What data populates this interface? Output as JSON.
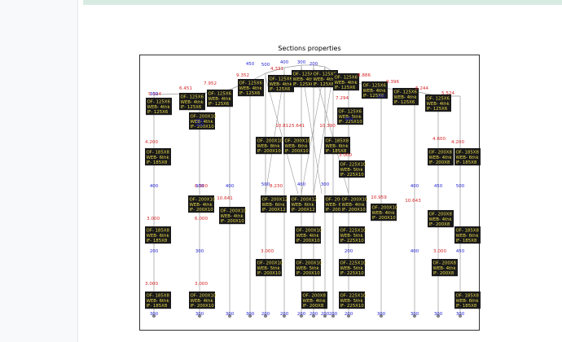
{
  "chart_data": {
    "type": "diagram",
    "title": "Sections properties",
    "labels": [
      {
        "lines": [
          "OF- 125X6",
          "WEB- 4thk",
          "IF- 125X6"
        ]
      },
      {
        "lines": [
          "OF- 125X6",
          "WEB- 4thk",
          "IF- 125X6"
        ]
      },
      {
        "lines": [
          "OF- 125X6",
          "WEB- 4thk",
          "IF- 125X6"
        ]
      },
      {
        "lines": [
          "OF- 125X6",
          "WEB- 4thk",
          "IF- 125X6"
        ]
      },
      {
        "lines": [
          "OF- 125X6",
          "WEB- 4thk",
          "IF- 125X6"
        ]
      },
      {
        "lines": [
          "OF- 125X6",
          "WEB- 4thk",
          "IF- 125X6"
        ]
      },
      {
        "lines": [
          "OF- 125X6",
          "WEB- 4thk",
          "IF- 125X6"
        ]
      },
      {
        "lines": [
          "OF- 125X6",
          "WEB- 4thk",
          "IF- 125X6"
        ]
      },
      {
        "lines": [
          "OF- 125X6",
          "WEB- 4thk",
          "IF- 125X6"
        ]
      },
      {
        "lines": [
          "OF- 125X6",
          "WEB- 4thk",
          "IF- 125X6"
        ]
      },
      {
        "lines": [
          "OF- 125X6",
          "WEB- 4thk",
          "IF- 125X6"
        ]
      },
      {
        "lines": [
          "OF- 200X10",
          "WEB- 4thk",
          "IF- 200X10"
        ]
      },
      {
        "lines": [
          "OF- 185X8",
          "WEB- 6thk",
          "IF- 185X8"
        ]
      },
      {
        "lines": [
          "OF- 200X10",
          "WEB- 4thk",
          "IF- 200X10"
        ]
      },
      {
        "lines": [
          "OF- 200X10",
          "WEB- 8thk",
          "IF- 200X10"
        ]
      },
      {
        "lines": [
          "OF- 200X10",
          "WEB- 6thk",
          "IF- 200X10"
        ]
      },
      {
        "lines": [
          "OF- 125X6",
          "WEB- 5thk",
          "IF- 225X10"
        ]
      },
      {
        "lines": [
          "OF- 225X10",
          "WEB- 5thk",
          "IF- 225X10"
        ]
      },
      {
        "lines": [
          "OF- 200X8",
          "WEB- 4thk",
          "IF- 200X8"
        ]
      },
      {
        "lines": [
          "OF- 185X8",
          "WEB- 6thk",
          "IF- 185X8"
        ]
      },
      {
        "lines": [
          "OF- 200X10",
          "WEB- 4thk",
          "IF- 200X10"
        ]
      },
      {
        "lines": [
          "OF- 200X10",
          "WEB- 4thk",
          "IF- 200X10"
        ]
      },
      {
        "lines": [
          "OF- 200X12",
          "WEB- 6thk",
          "IF- 200X12"
        ]
      },
      {
        "lines": [
          "OF- 200X12",
          "WEB- 6thk",
          "IF- 200X12"
        ]
      },
      {
        "lines": [
          "OF- 200X12",
          "WEB- 6thk",
          "IF- 200X12"
        ]
      },
      {
        "lines": [
          "OF- 200X10",
          "WEB- 4thk",
          "IF- 200X10"
        ]
      },
      {
        "lines": [
          "OF- 200X8",
          "WEB- 4thk",
          "IF- 200X8"
        ]
      },
      {
        "lines": [
          "OF- 185X8",
          "WEB- 6thk",
          "IF- 185X8"
        ]
      },
      {
        "lines": [
          "OF- 185X8",
          "WEB- 6thk",
          "IF- 185X8"
        ]
      },
      {
        "lines": [
          "OF- 200X10",
          "WEB- 4thk",
          "IF- 200X10"
        ]
      },
      {
        "lines": [
          "OF- 225X10",
          "WEB- 5thk",
          "IF- 225X10"
        ]
      },
      {
        "lines": [
          "OF- 200X10",
          "WEB- 5thk",
          "IF- 200X10"
        ]
      },
      {
        "lines": [
          "OF- 200X10",
          "WEB- 5thk",
          "IF- 200X10"
        ]
      },
      {
        "lines": [
          "OF- 225X10",
          "WEB- 5thk",
          "IF- 225X10"
        ]
      },
      {
        "lines": [
          "OF- 200X8",
          "WEB- 4thk",
          "IF- 200X8"
        ]
      },
      {
        "lines": [
          "OF- 185X8",
          "WEB- 6thk",
          "IF- 185X8"
        ]
      },
      {
        "lines": [
          "OF- 185X8",
          "WEB- 6thk",
          "IF- 185X8"
        ]
      },
      {
        "lines": [
          "OF- 200X10",
          "WEB- 4thk",
          "IF- 200X10"
        ]
      },
      {
        "lines": [
          "OF- 200X8",
          "WEB- 4thk",
          "IF- 200X8"
        ]
      },
      {
        "lines": [
          "OF- 225X10",
          "WEB- 5thk",
          "IF- 225X10"
        ]
      },
      {
        "lines": [
          "OF- 185X8",
          "WEB- 6thk",
          "IF- 185X8"
        ]
      }
    ],
    "length_labels": [
      "5.524",
      "6.451",
      "7.952",
      "9.352",
      "4.331",
      "8.886",
      "9.396",
      "6.244",
      "5.524",
      "7.294",
      "3.000",
      "4.200",
      "6.500",
      "10.641",
      "8.230",
      "10.959",
      "10.643",
      "4.600",
      "4.200",
      "3.000",
      "6.000",
      "3.000",
      "3.000",
      "3.000",
      "3.000",
      "5.641",
      "10.390",
      "10.812"
    ],
    "spacing_labels": [
      "300",
      "200",
      "400",
      "450",
      "500",
      "400",
      "300",
      "200"
    ]
  },
  "colors": {
    "label_bg": "#1a1a1a",
    "label_text": "#e8d84a",
    "length_text": "#d62728",
    "spacing_text": "#1f1fd6",
    "member_line": "#999999",
    "node": "#888888"
  }
}
